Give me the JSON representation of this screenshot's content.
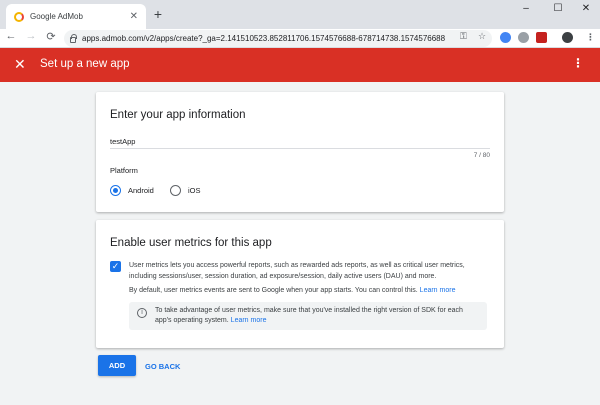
{
  "browser": {
    "tab_title": "Google AdMob",
    "tab_close": "✕",
    "new_tab": "+",
    "window_controls": {
      "minimize": "–",
      "maximize": "☐",
      "close": "✕"
    },
    "nav": {
      "back": "←",
      "forward": "→",
      "reload": "⟳"
    },
    "url": "apps.admob.com/v2/apps/create?_ga=2.141510523.852811706.1574576688-678714738.1574576688",
    "icons": {
      "key": "⚿",
      "star": "☆",
      "menu": "⋮"
    }
  },
  "appbar": {
    "close": "✕",
    "title": "Set up a new app",
    "more": "⋮"
  },
  "app_info": {
    "heading": "Enter your app information",
    "app_name_value": "testApp",
    "char_counter": "7 / 80",
    "platform_label": "Platform",
    "platforms": [
      {
        "label": "Android",
        "selected": true
      },
      {
        "label": "iOS",
        "selected": false
      }
    ]
  },
  "user_metrics": {
    "heading": "Enable user metrics for this app",
    "checked": true,
    "checkmark": "✓",
    "description": "User metrics lets you access powerful reports, such as rewarded ads reports, as well as critical user metrics, including sessions/user, session duration, ad exposure/session, daily active users (DAU) and more.",
    "default_text": "By default, user metrics events are sent to Google when your app starts. You can control this.",
    "default_link": "Learn more",
    "info_icon": "i",
    "info_text": "To take advantage of user metrics, make sure that you've installed the right version of SDK for each app's operating system.",
    "info_link": "Learn more"
  },
  "actions": {
    "add": "ADD",
    "go_back": "GO BACK"
  },
  "colors": {
    "appbar": "#d93025",
    "accent": "#1a73e8",
    "background": "#f1f3f4"
  }
}
